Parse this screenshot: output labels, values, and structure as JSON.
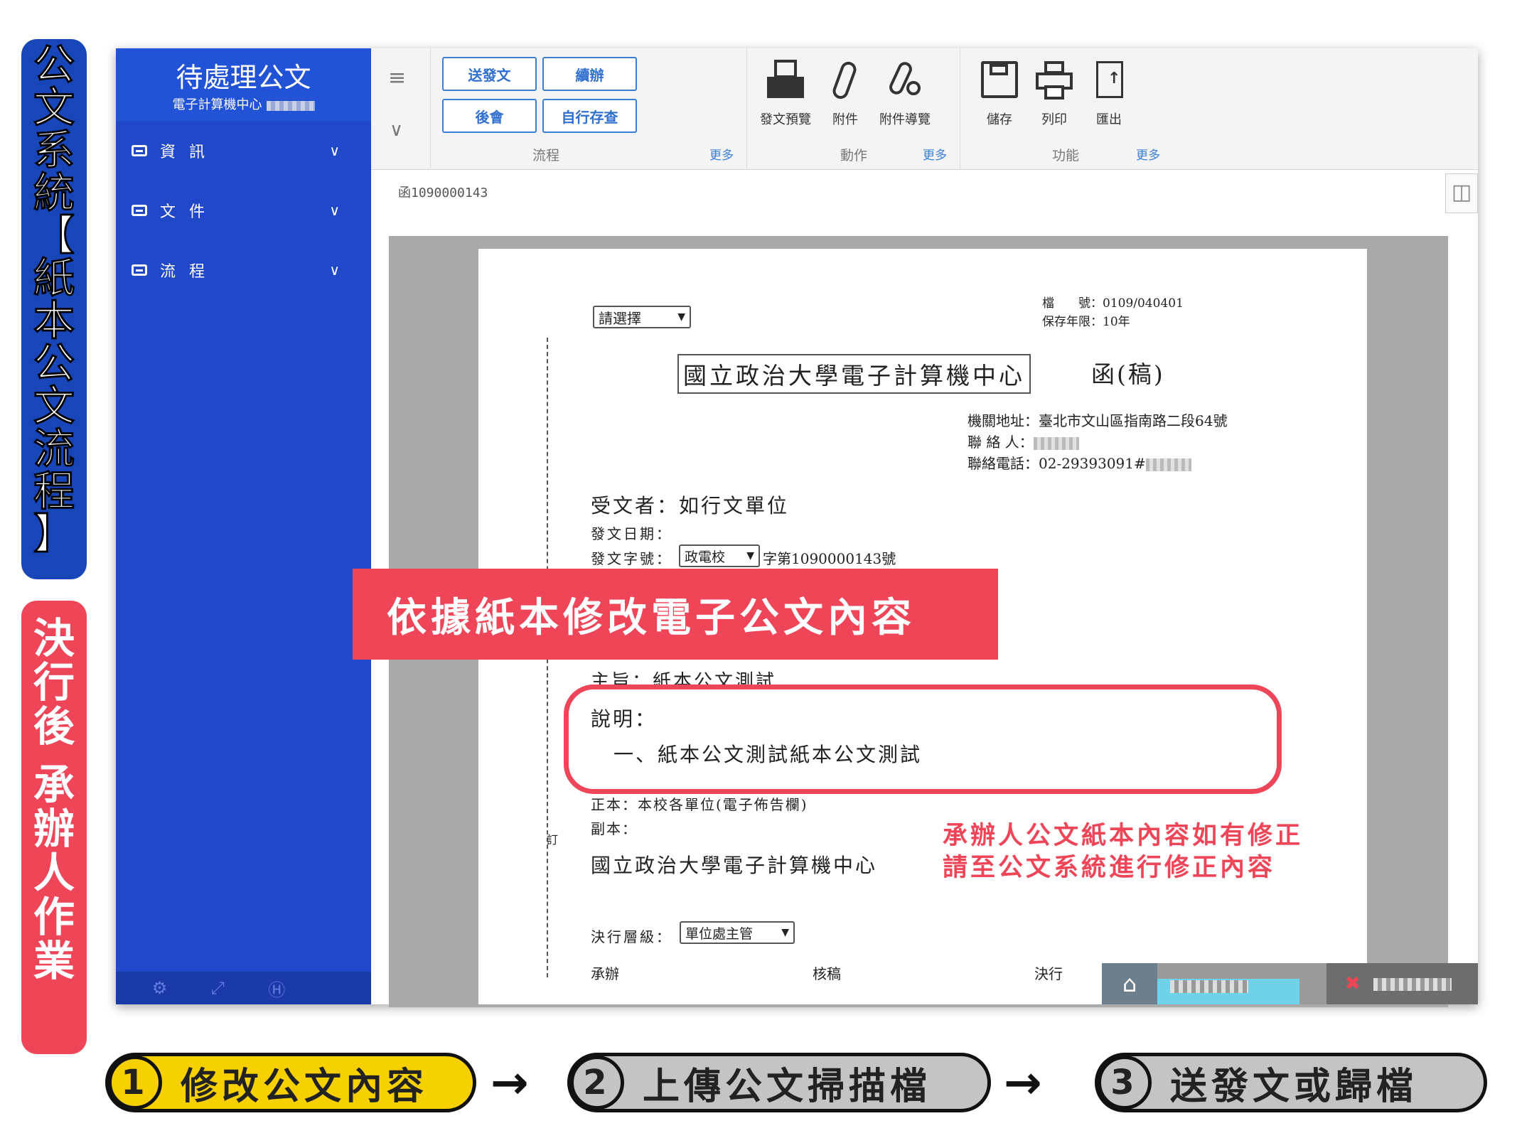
{
  "labels": {
    "side_blue": [
      "公",
      "文",
      "系",
      "統",
      "【",
      "紙",
      "本",
      "公",
      "文",
      "流",
      "程",
      "】"
    ],
    "side_red": [
      "決",
      "行",
      "後",
      "承",
      "辦",
      "人",
      "作",
      "業"
    ]
  },
  "sidebar": {
    "title": "待處理公文",
    "subtitle": "電子計算機中心",
    "items": [
      {
        "label": "資 訊"
      },
      {
        "label": "文 件"
      },
      {
        "label": "流 程"
      }
    ],
    "footer_icons": [
      "gear-icon",
      "expand-icon",
      "help-icon"
    ]
  },
  "toolbar": {
    "flow_buttons": [
      "送發文",
      "續辦",
      "後會",
      "自行存查"
    ],
    "groups": [
      {
        "label": "流程",
        "more": "更多"
      },
      {
        "label": "動作",
        "more": "更多"
      },
      {
        "label": "功能",
        "more": "更多"
      }
    ],
    "action_tools": [
      "發文預覽",
      "附件",
      "附件導覽"
    ],
    "function_tools": [
      "儲存",
      "列印",
      "匯出"
    ]
  },
  "doc_id": "函1090000143",
  "document": {
    "template_select": "請選擇",
    "file_no": "檔　　號：0109/040401",
    "retention": "保存年限：10年",
    "org_title": "國立政治大學電子計算機中心",
    "doc_type": "函(稿)",
    "address": "機關地址：臺北市文山區指南路二段64號",
    "contact_label": "聯 絡 人：",
    "phone_label": "聯絡電話：02-29393091#",
    "recipient": "受文者：如行文單位",
    "send_date": "發文日期：",
    "send_no_label": "發文字號：",
    "send_no_select": "政電校",
    "send_no_suffix": "字第1090000143號",
    "subject": "主旨：紙本公文測試",
    "desc_label": "說明：",
    "desc_item": "一、紙本公文測試紙本公文測試",
    "main_copy": "正本：本校各單位(電子佈告欄)",
    "secondary_copy": "副本：",
    "signature": "國立政治大學電子計算機中心",
    "margin_mark": "訂",
    "approval_level_label": "決行層級：",
    "approval_level_select": "單位處主管",
    "sign_cols": [
      "承辦",
      "核稿",
      "決行"
    ]
  },
  "annotations": {
    "banner": "依據紙本修改電子公文內容",
    "note_line1": "承辦人公文紙本內容如有修正",
    "note_line2": "請至公文系統進行修正內容"
  },
  "steps": [
    {
      "num": "1",
      "label": "修改公文內容"
    },
    {
      "num": "2",
      "label": "上傳公文掃描檔"
    },
    {
      "num": "3",
      "label": "送發文或歸檔"
    }
  ],
  "colors": {
    "brand_blue": "#2048c8",
    "accent_red": "#ef4558",
    "step1_fill": "#f7d000",
    "step_gray": "#c4c4c4"
  }
}
